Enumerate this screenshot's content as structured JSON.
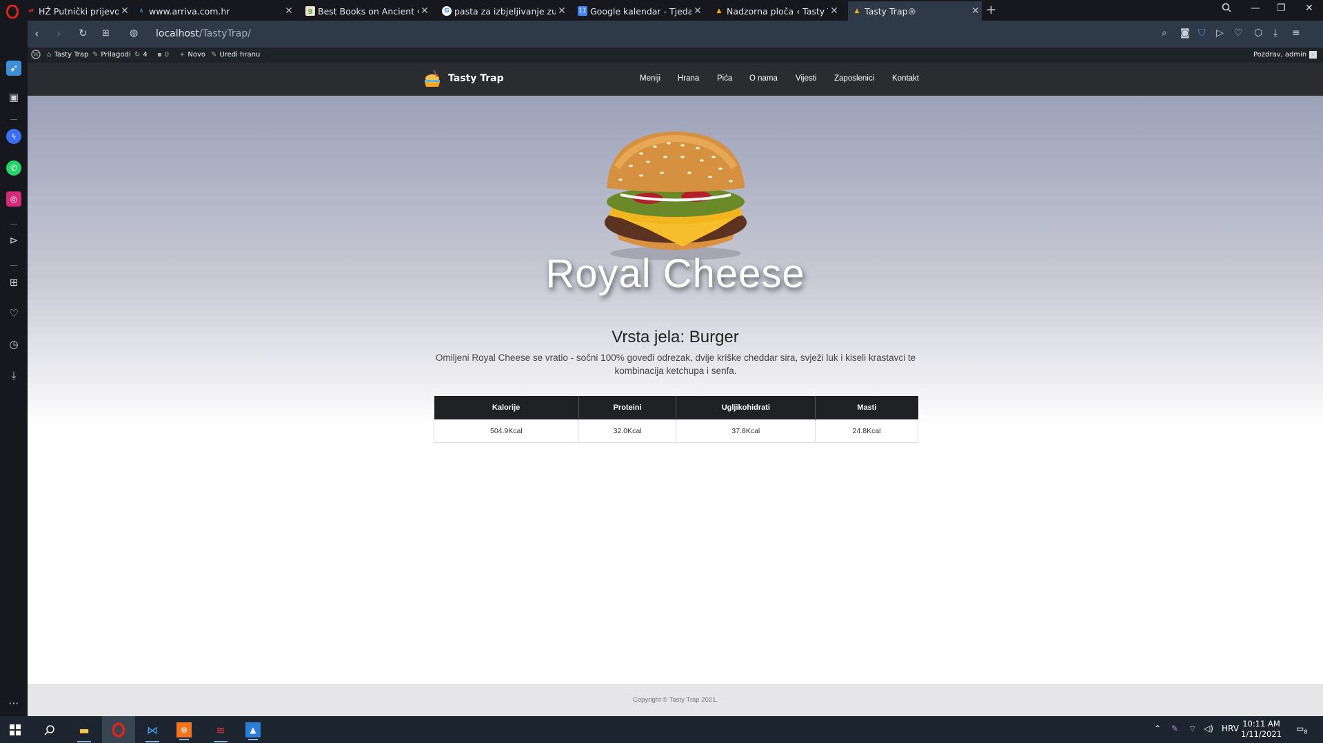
{
  "browser": {
    "tabs": [
      {
        "title": "HŽ Putnički prijevoz",
        "favicon": "hz-icon",
        "close": "✕"
      },
      {
        "title": "www.arriva.com.hr",
        "favicon": "arriva-icon",
        "close": "✕"
      },
      {
        "title": "Best Books on Ancient Gre",
        "favicon": "goodreads-icon",
        "close": "✕"
      },
      {
        "title": "pasta za izbjeljivanje zubi -",
        "favicon": "google-icon",
        "close": "✕"
      },
      {
        "title": "Google kalendar - Tjedan o",
        "favicon": "calendar-icon",
        "close": "✕"
      },
      {
        "title": "Nadzorna ploča ‹ Tasty Trap",
        "favicon": "tasty-icon",
        "close": "✕"
      },
      {
        "title": "Tasty Trap®",
        "favicon": "tasty-icon",
        "close": "✕"
      }
    ],
    "url_host": "localhost",
    "url_path": "/TastyTrap/"
  },
  "wp_admin_bar": {
    "site_name": "Tasty Trap",
    "customize": "Prilagodi",
    "updates_count": "4",
    "comments_count": "0",
    "new": "Novo",
    "edit": "Uredi hranu",
    "greeting": "Pozdrav, admin"
  },
  "site": {
    "brand": "Tasty Trap",
    "nav": [
      "Meniji",
      "Hrana",
      "Pića",
      "O nama",
      "Vijesti",
      "Zaposlenici",
      "Kontakt"
    ]
  },
  "food": {
    "name": "Royal Cheese",
    "type_line": "Vrsta jela: Burger",
    "description": "Omiljeni Royal Cheese se vratio - sočni 100% goveđi odrezak, dvije kriške cheddar sira, svježi luk i kiseli krastavci te kombinacija ketchupa i senfa."
  },
  "nutrition": {
    "headers": [
      "Kalorije",
      "Proteini",
      "Ugljikohidrati",
      "Masti"
    ],
    "values": [
      "504.9Kcal",
      "32.0Kcal",
      "37.8Kcal",
      "24.8Kcal"
    ]
  },
  "footer": {
    "copyright": "Copyright © Tasty Trap 2021."
  },
  "taskbar": {
    "language": "HRV",
    "time": "10:11 AM",
    "date": "1/11/2021",
    "notification_count": "8"
  },
  "colors": {
    "header_bg": "#2b2c30",
    "table_header_bg": "#202125",
    "opera_red": "#e0261b"
  }
}
